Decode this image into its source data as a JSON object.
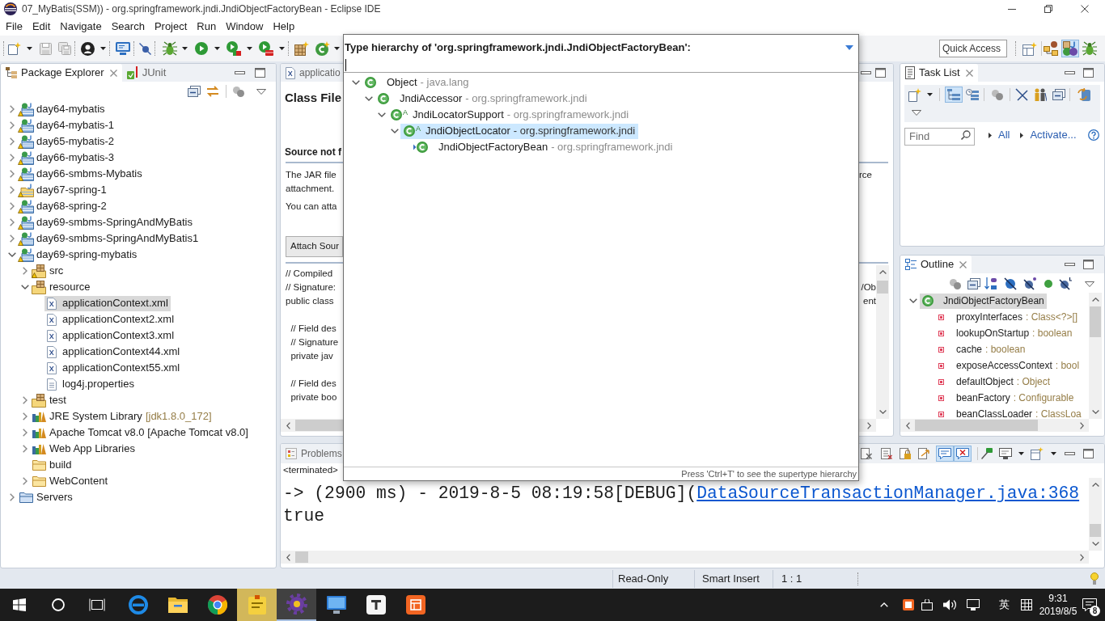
{
  "window": {
    "title": "07_MyBatis(SSM)) - org.springframework.jndi.JndiObjectFactoryBean - Eclipse IDE"
  },
  "menu": [
    "File",
    "Edit",
    "Navigate",
    "Search",
    "Project",
    "Run",
    "Window",
    "Help"
  ],
  "toolbar": {
    "quick_access": {
      "placeholder": "Quick Access"
    },
    "perspectives": [
      {
        "kind": "javaee",
        "selected": false
      },
      {
        "kind": "java",
        "selected": true
      },
      {
        "kind": "debug",
        "selected": false
      }
    ]
  },
  "package_explorer": {
    "tabs": [
      {
        "label": "Package Explorer",
        "selected": true
      },
      {
        "label": "JUnit",
        "selected": false
      }
    ],
    "tree": [
      {
        "label": "day64-mybatis",
        "kind": "web_project",
        "warning": true,
        "expanded": false,
        "selected": false
      },
      {
        "label": "day64-mybatis-1",
        "kind": "web_project",
        "warning": true,
        "expanded": false,
        "selected": false
      },
      {
        "label": "day65-mybatis-2",
        "kind": "web_project",
        "warning": true,
        "expanded": false,
        "selected": false
      },
      {
        "label": "day66-mybatis-3",
        "kind": "web_project",
        "warning": true,
        "expanded": false,
        "selected": false
      },
      {
        "label": "day66-smbms-Mybatis",
        "kind": "web_project",
        "warning": true,
        "expanded": false,
        "selected": false
      },
      {
        "label": "day67-spring-1",
        "kind": "java_project",
        "warning": true,
        "expanded": false,
        "selected": false
      },
      {
        "label": "day68-spring-2",
        "kind": "web_project",
        "warning": true,
        "expanded": false,
        "selected": false
      },
      {
        "label": "day69-smbms-SpringAndMyBatis",
        "kind": "web_project",
        "warning": true,
        "expanded": false,
        "selected": false
      },
      {
        "label": "day69-smbms-SpringAndMyBatis1",
        "kind": "web_project",
        "warning": true,
        "expanded": false,
        "selected": false
      },
      {
        "label": "day69-spring-mybatis",
        "kind": "web_project",
        "warning": true,
        "expanded": true,
        "selected": false,
        "children": [
          {
            "label": "src",
            "kind": "source_folder",
            "warning": true,
            "expanded": false,
            "selected": false
          },
          {
            "label": "resource",
            "kind": "source_folder",
            "warning": false,
            "expanded": true,
            "selected": false,
            "children": [
              {
                "label": "applicationContext.xml",
                "kind": "xml_file",
                "selected": true
              },
              {
                "label": "applicationContext2.xml",
                "kind": "xml_file",
                "selected": false
              },
              {
                "label": "applicationContext3.xml",
                "kind": "xml_file",
                "selected": false
              },
              {
                "label": "applicationContext44.xml",
                "kind": "xml_file",
                "selected": false
              },
              {
                "label": "applicationContext55.xml",
                "kind": "xml_file",
                "selected": false
              },
              {
                "label": "log4j.properties",
                "kind": "text_file",
                "selected": false
              }
            ]
          },
          {
            "label": "test",
            "kind": "source_folder",
            "warning": false,
            "expanded": false,
            "selected": false
          },
          {
            "label": "JRE System Library",
            "decoration": "[jdk1.8.0_172]",
            "kind": "library",
            "expanded": false,
            "selected": false
          },
          {
            "label": "Apache Tomcat v8.0 [Apache Tomcat v8.0]",
            "kind": "library",
            "expanded": false,
            "selected": false
          },
          {
            "label": "Web App Libraries",
            "kind": "library",
            "expanded": false,
            "selected": false
          },
          {
            "label": "build",
            "kind": "folder",
            "selected": false
          },
          {
            "label": "WebContent",
            "kind": "folder",
            "expanded": false,
            "selected": false
          }
        ]
      },
      {
        "label": "Servers",
        "kind": "server_folder",
        "expanded": false,
        "selected": false
      }
    ]
  },
  "editor": {
    "tabs": [
      {
        "label": "applicatio",
        "selected": false
      }
    ],
    "title": "Class File",
    "section_title": "Source not f",
    "message": [
      {
        "text": "The JAR file",
        "tail": "rce"
      },
      {
        "text": "attachment."
      }
    ],
    "hint": "You can atta",
    "attach_button": "Attach Sour",
    "code": [
      [
        {
          "text": "// Compiled"
        },
        {
          "text": "// Signature:",
          "tail": "/Ob"
        },
        {
          "text": "public class",
          "tail": "ent"
        }
      ],
      [
        {
          "text": "  // Field des"
        },
        {
          "text": "  // Signature"
        },
        {
          "text": "  private jav"
        }
      ],
      [
        {
          "text": "  // Field des"
        },
        {
          "text": "  private boo"
        }
      ]
    ]
  },
  "task_list": {
    "tabs": [
      {
        "label": "Task List",
        "selected": true
      }
    ],
    "toggles": [
      {
        "pressed": true
      },
      {
        "pressed": false
      }
    ],
    "find": {
      "placeholder": "Find"
    },
    "links": [
      "All",
      "Activate..."
    ]
  },
  "outline": {
    "tabs": [
      {
        "label": "Outline",
        "selected": true
      }
    ],
    "tree": [
      {
        "label": "JndiObjectFactoryBean",
        "kind": "class",
        "expanded": true,
        "selected": true,
        "children": [
          {
            "label": "proxyInterfaces",
            "detail": ": Class<?>[]",
            "kind": "field",
            "selected": false
          },
          {
            "label": "lookupOnStartup",
            "detail": ": boolean",
            "kind": "field",
            "selected": false
          },
          {
            "label": "cache",
            "detail": ": boolean",
            "kind": "field",
            "selected": false
          },
          {
            "label": "exposeAccessContext",
            "detail": ": bool",
            "kind": "field",
            "selected": false
          },
          {
            "label": "defaultObject",
            "detail": ": Object",
            "kind": "field",
            "selected": false
          },
          {
            "label": "beanFactory",
            "detail": ": Configurable",
            "kind": "field",
            "selected": false
          },
          {
            "label": "beanClassLoader",
            "detail": ": ClassLoa",
            "kind": "field",
            "selected": false
          }
        ]
      }
    ]
  },
  "console": {
    "tabs": [
      {
        "label": "Problems",
        "selected": false
      }
    ],
    "toggles": [
      {
        "pressed": true
      },
      {
        "pressed": true
      }
    ],
    "process": "<terminated>",
    "lines": [
      {
        "text": "-> (2900 ms) - 2019-8-5 08:19:58[DEBUG](",
        "link": "DataSourceTransactionManager.java:368"
      },
      {
        "text": "true"
      }
    ]
  },
  "status_bar": [
    "Read-Only",
    "Smart Insert",
    "1 : 1"
  ],
  "taskbar": {
    "apps": [
      {
        "kind": "e_browser",
        "active": false,
        "flashing": false
      },
      {
        "kind": "file_folder",
        "active": false,
        "flashing": false
      },
      {
        "kind": "round_browser",
        "active": false,
        "flashing": false
      },
      {
        "kind": "note",
        "active": false,
        "flashing": true
      },
      {
        "kind": "ide",
        "active": true,
        "flashing": false
      },
      {
        "kind": "monitor",
        "active": false,
        "flashing": false
      },
      {
        "kind": "t_tile",
        "active": false,
        "flashing": false
      },
      {
        "kind": "orange_tile",
        "active": false,
        "flashing": false
      }
    ],
    "tray": {
      "ime": "英",
      "time": "9:31",
      "date": "2019/8/5",
      "notifications": "8"
    }
  },
  "type_hierarchy": {
    "title": "Type hierarchy of 'org.springframework.jndi.JndiObjectFactoryBean':",
    "tree": [
      {
        "name": "Object",
        "qualifier": "- java.lang",
        "expanded": true,
        "selected": false,
        "children": [
          {
            "name": "JndiAccessor",
            "qualifier": "- org.springframework.jndi",
            "expanded": true,
            "selected": false,
            "children": [
              {
                "name": "JndiLocatorSupport",
                "overlay": "A",
                "qualifier": "- org.springframework.jndi",
                "expanded": true,
                "selected": false,
                "children": [
                  {
                    "name": "JndiObjectLocator",
                    "overlay": "A",
                    "qualifier": "- org.springframework.jndi",
                    "expanded": true,
                    "selected": true,
                    "children": [
                      {
                        "name": "JndiObjectFactoryBean",
                        "qualifier": "- org.springframework.jndi",
                        "focus": true,
                        "selected": false
                      }
                    ]
                  }
                ]
              }
            ]
          }
        ]
      }
    ],
    "footer": "Press 'Ctrl+T' to see the supertype hierarchy"
  }
}
